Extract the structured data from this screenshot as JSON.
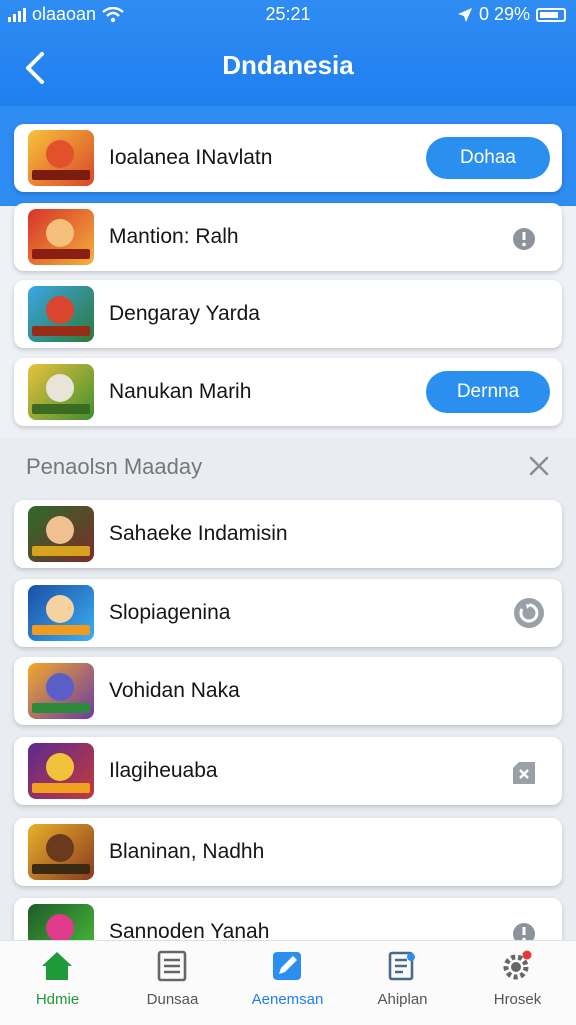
{
  "status_bar": {
    "carrier": "olaaoan",
    "time": "25:21",
    "battery": "0 29%"
  },
  "header": {
    "title": "Dndanesia"
  },
  "top_list": [
    {
      "name": "Ioalanea INavlatn",
      "button": "Dohaa"
    },
    {
      "name": "Mantion: Ralh",
      "icon": "info-icon"
    },
    {
      "name": "Dengaray Yarda"
    },
    {
      "name": "Nanukan Marih",
      "button": "Dernna"
    }
  ],
  "section": {
    "title": "Penaolsn Maaday"
  },
  "section_list": [
    {
      "name": "Sahaeke Indamisin"
    },
    {
      "name": "Slopiagenina",
      "icon": "refresh-icon"
    },
    {
      "name": "Vohidan Naka"
    },
    {
      "name": "Ilagiheuaba",
      "icon": "clear-icon"
    },
    {
      "name": "Blaninan, Nadhh"
    },
    {
      "name": "Sannoden Yanah",
      "icon": "info-icon"
    }
  ],
  "tabs": [
    {
      "label": "Hdmie"
    },
    {
      "label": "Dunsaa"
    },
    {
      "label": "Aenemsan"
    },
    {
      "label": "Ahiplan"
    },
    {
      "label": "Hrosek"
    }
  ],
  "colors": {
    "accent": "#2f8cf2",
    "button": "#2b8ff0"
  }
}
